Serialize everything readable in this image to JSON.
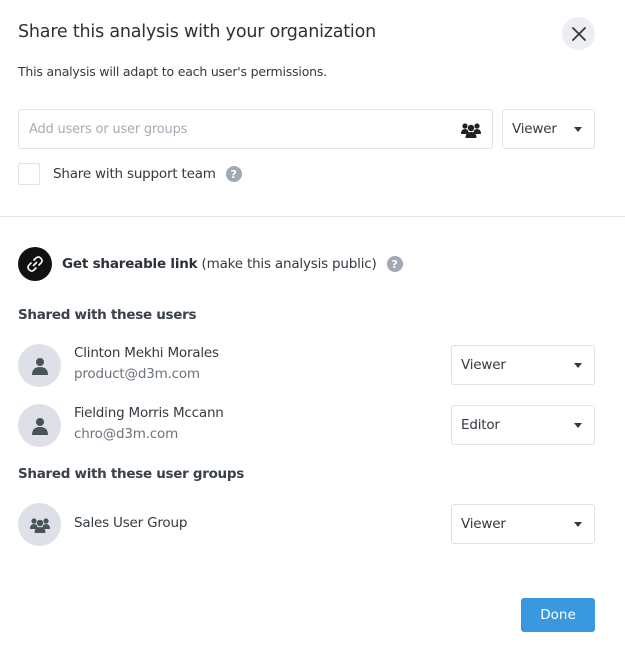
{
  "dialog": {
    "title": "Share this analysis with your organization",
    "subtitle": "This analysis will adapt to each user's permissions.",
    "close_icon": "close-icon"
  },
  "add": {
    "input_value": "",
    "placeholder": "Add users or user groups",
    "icon": "user-group-icon",
    "role": "Viewer"
  },
  "support": {
    "checked": false,
    "label": "Share with support team",
    "help": "?"
  },
  "link": {
    "icon": "link-icon",
    "bold": "Get shareable link",
    "rest": " (make this analysis public)",
    "help": "?"
  },
  "users_section": {
    "title": "Shared with these users",
    "users": [
      {
        "name": "Clinton Mekhi Morales",
        "email": "product@d3m.com",
        "role": "Viewer"
      },
      {
        "name": "Fielding Morris Mccann",
        "email": "chro@d3m.com",
        "role": "Editor"
      }
    ]
  },
  "groups_section": {
    "title": "Shared with these user groups",
    "groups": [
      {
        "name": "Sales User Group",
        "role": "Viewer"
      }
    ]
  },
  "footer": {
    "done_label": "Done"
  },
  "colors": {
    "primary": "#3a98e0",
    "avatar_bg": "#dde1e7",
    "border": "#dfe3e8"
  }
}
